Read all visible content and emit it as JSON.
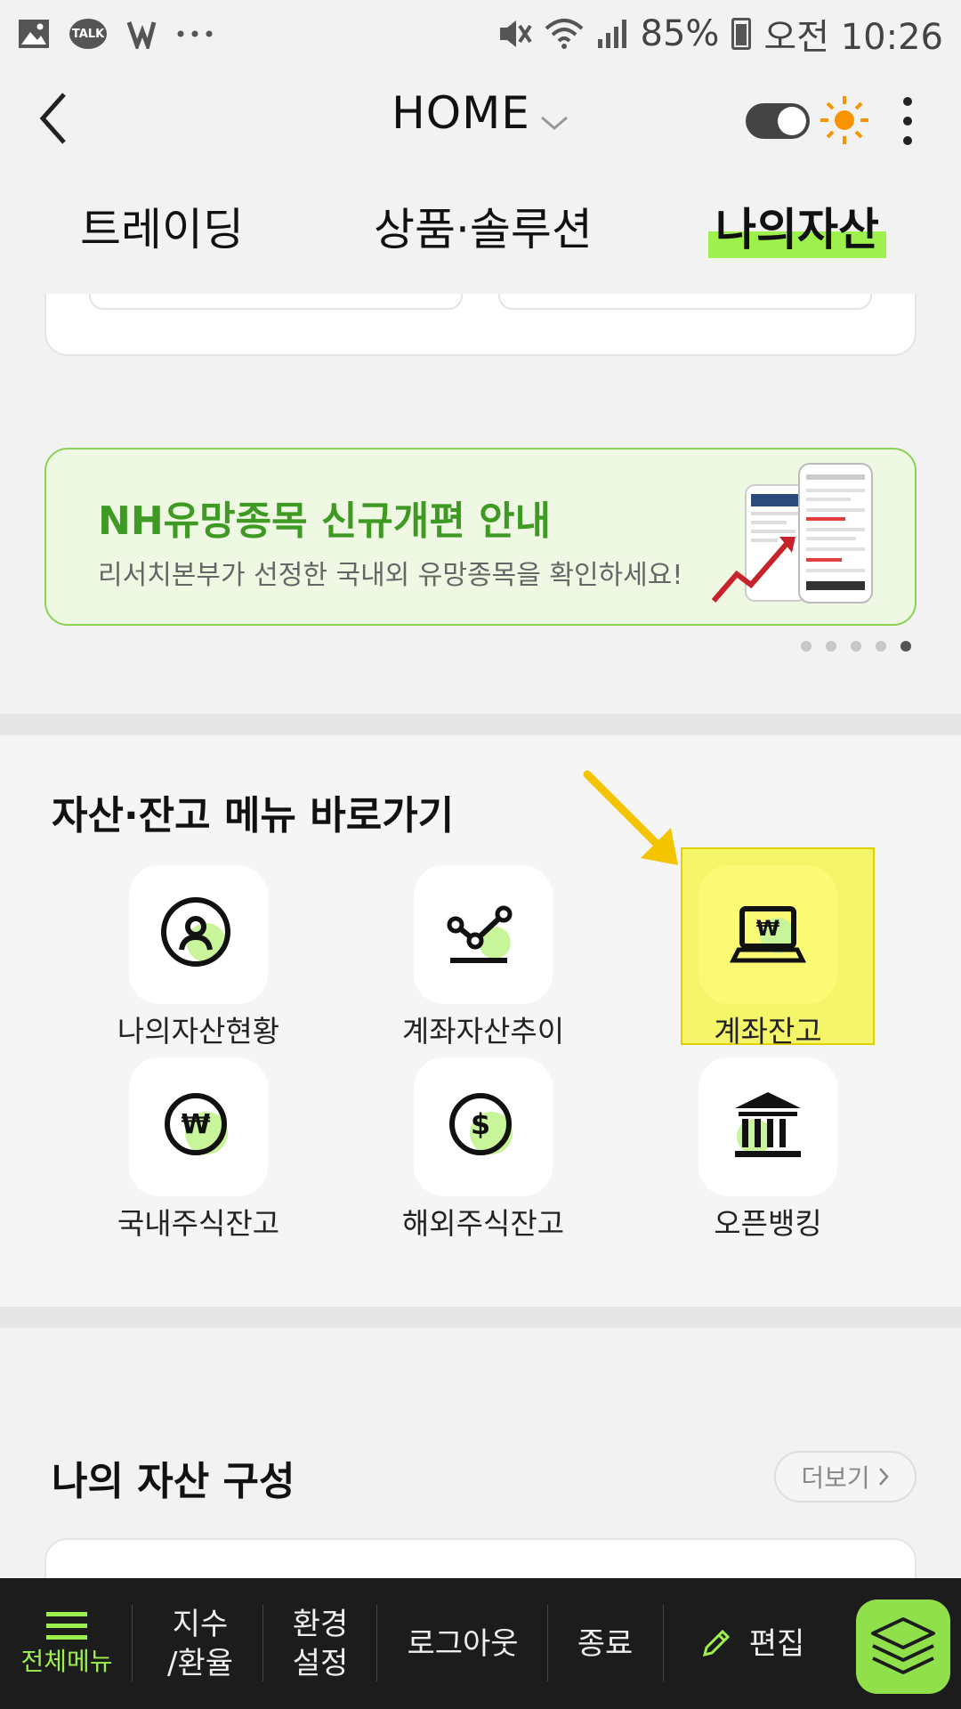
{
  "status_bar": {
    "talk_label": "TALK",
    "battery": "85%",
    "time": "오전 10:26",
    "icons": [
      "gallery-icon",
      "kakaotalk-icon",
      "vpn-icon",
      "more-notifications-icon",
      "mute-icon",
      "wifi-icon",
      "signal-icon",
      "battery-icon"
    ]
  },
  "header": {
    "title": "HOME",
    "theme_toggle": "on"
  },
  "tabs": [
    {
      "label": "트레이딩",
      "active": false
    },
    {
      "label": "상품·솔루션",
      "active": false
    },
    {
      "label": "나의자산",
      "active": true
    }
  ],
  "banner": {
    "title": "NH유망종목 신규개편 안내",
    "subtitle": "리서치본부가 선정한 국내외 유망종목을 확인하세요!",
    "page_count": 5,
    "active_page": 5
  },
  "shortcuts": {
    "title": "자산·잔고 메뉴 바로가기",
    "items": [
      {
        "label": "나의자산현황",
        "icon": "person-circle-icon"
      },
      {
        "label": "계좌자산추이",
        "icon": "trend-line-icon"
      },
      {
        "label": "계좌잔고",
        "icon": "laptop-won-icon",
        "highlighted": true
      },
      {
        "label": "국내주식잔고",
        "icon": "won-coin-icon"
      },
      {
        "label": "해외주식잔고",
        "icon": "dollar-coin-icon"
      },
      {
        "label": "오픈뱅킹",
        "icon": "bank-icon"
      }
    ]
  },
  "assets": {
    "title": "나의 자산 구성",
    "more_label": "더보기"
  },
  "bottom_nav": {
    "menu_label": "전체메뉴",
    "index_line1": "지수",
    "index_line2": "/환율",
    "settings_line1": "환경",
    "settings_line2": "설정",
    "logout": "로그아웃",
    "exit": "종료",
    "edit": "편집"
  },
  "colors": {
    "accent_green": "#9ef04d",
    "banner_green": "#3f9a23",
    "highlight_yellow": "#f5f56a",
    "arrow_yellow": "#f5c400"
  }
}
